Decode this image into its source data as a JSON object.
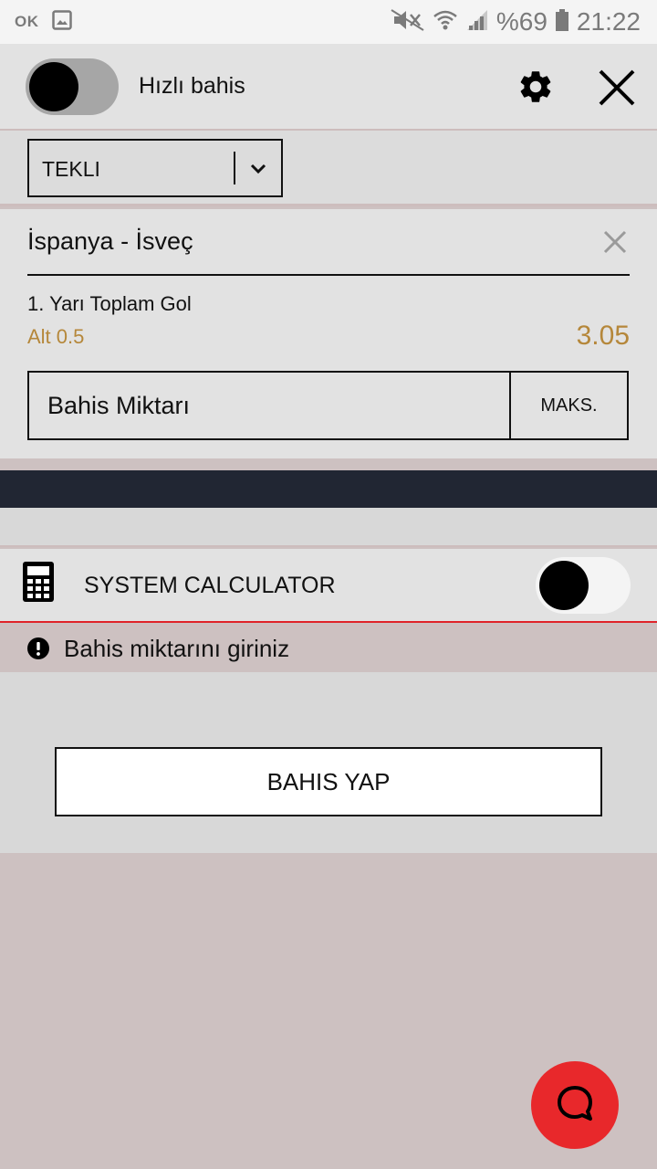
{
  "status_bar": {
    "left_text": "OK",
    "battery_text": "%69",
    "time": "21:22",
    "icons": [
      "gallery-icon",
      "mute-icon",
      "wifi-icon",
      "signal-icon",
      "battery-icon"
    ]
  },
  "header": {
    "quick_bet_label": "Hızlı bahis",
    "quick_bet_enabled": false,
    "icons": [
      "gear-icon",
      "close-icon"
    ]
  },
  "bet_type": {
    "selected": "TEKLI",
    "icon": "chevron-down-icon"
  },
  "bet": {
    "match": "İspanya - İsveç",
    "market": "1. Yarı Toplam Gol",
    "selection": "Alt 0.5",
    "odds": "3.05",
    "stake_placeholder": "Bahis Miktarı",
    "max_label": "MAKS."
  },
  "system_calculator": {
    "label": "SYSTEM CALCULATOR",
    "enabled": false,
    "icon": "calculator-icon"
  },
  "warning": {
    "text": "Bahis miktarını giriniz",
    "icon": "exclamation-icon"
  },
  "actions": {
    "place_bet_label": "BAHIS YAP",
    "chat_icon": "chat-icon"
  },
  "colors": {
    "odds": "#b5873a",
    "accent_red": "#e8282b",
    "dark_band": "#212633"
  }
}
